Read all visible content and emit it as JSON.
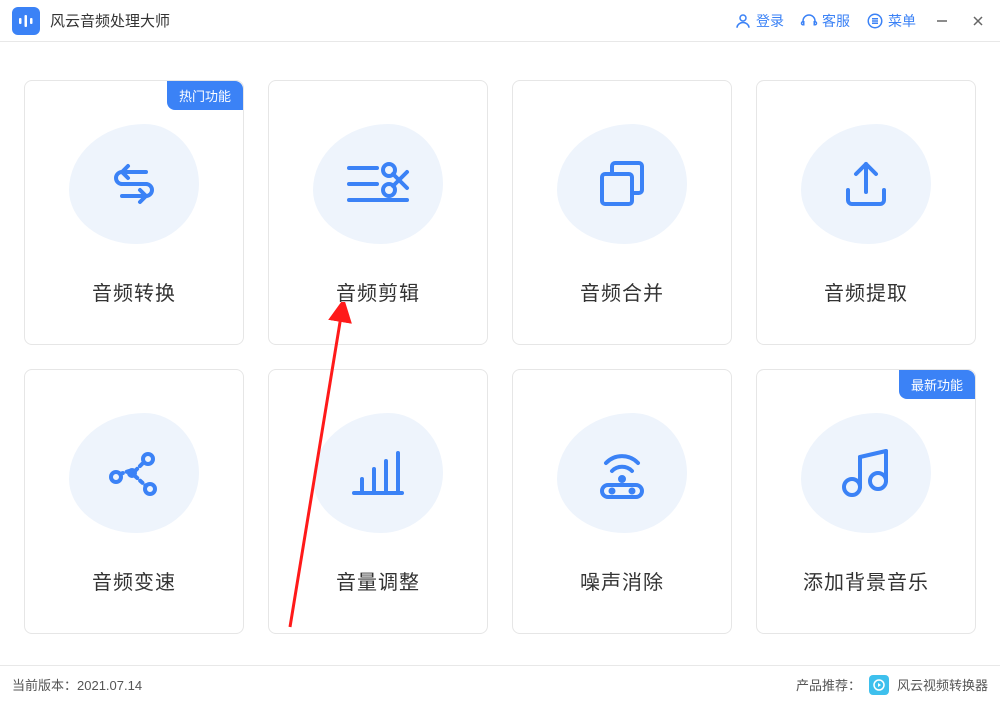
{
  "app": {
    "title": "风云音频处理大师"
  },
  "titlebar": {
    "login": "登录",
    "support": "客服",
    "menu": "菜单"
  },
  "cards": [
    {
      "label": "音频转换",
      "badge": "热门功能"
    },
    {
      "label": "音频剪辑"
    },
    {
      "label": "音频合并"
    },
    {
      "label": "音频提取"
    },
    {
      "label": "音频变速"
    },
    {
      "label": "音量调整"
    },
    {
      "label": "噪声消除"
    },
    {
      "label": "添加背景音乐",
      "badge": "最新功能"
    }
  ],
  "status": {
    "version_label": "当前版本：",
    "version": "2021.07.14",
    "recommend_label": "产品推荐：",
    "recommend_product": "风云视频转换器"
  },
  "colors": {
    "accent": "#3b82f6"
  }
}
